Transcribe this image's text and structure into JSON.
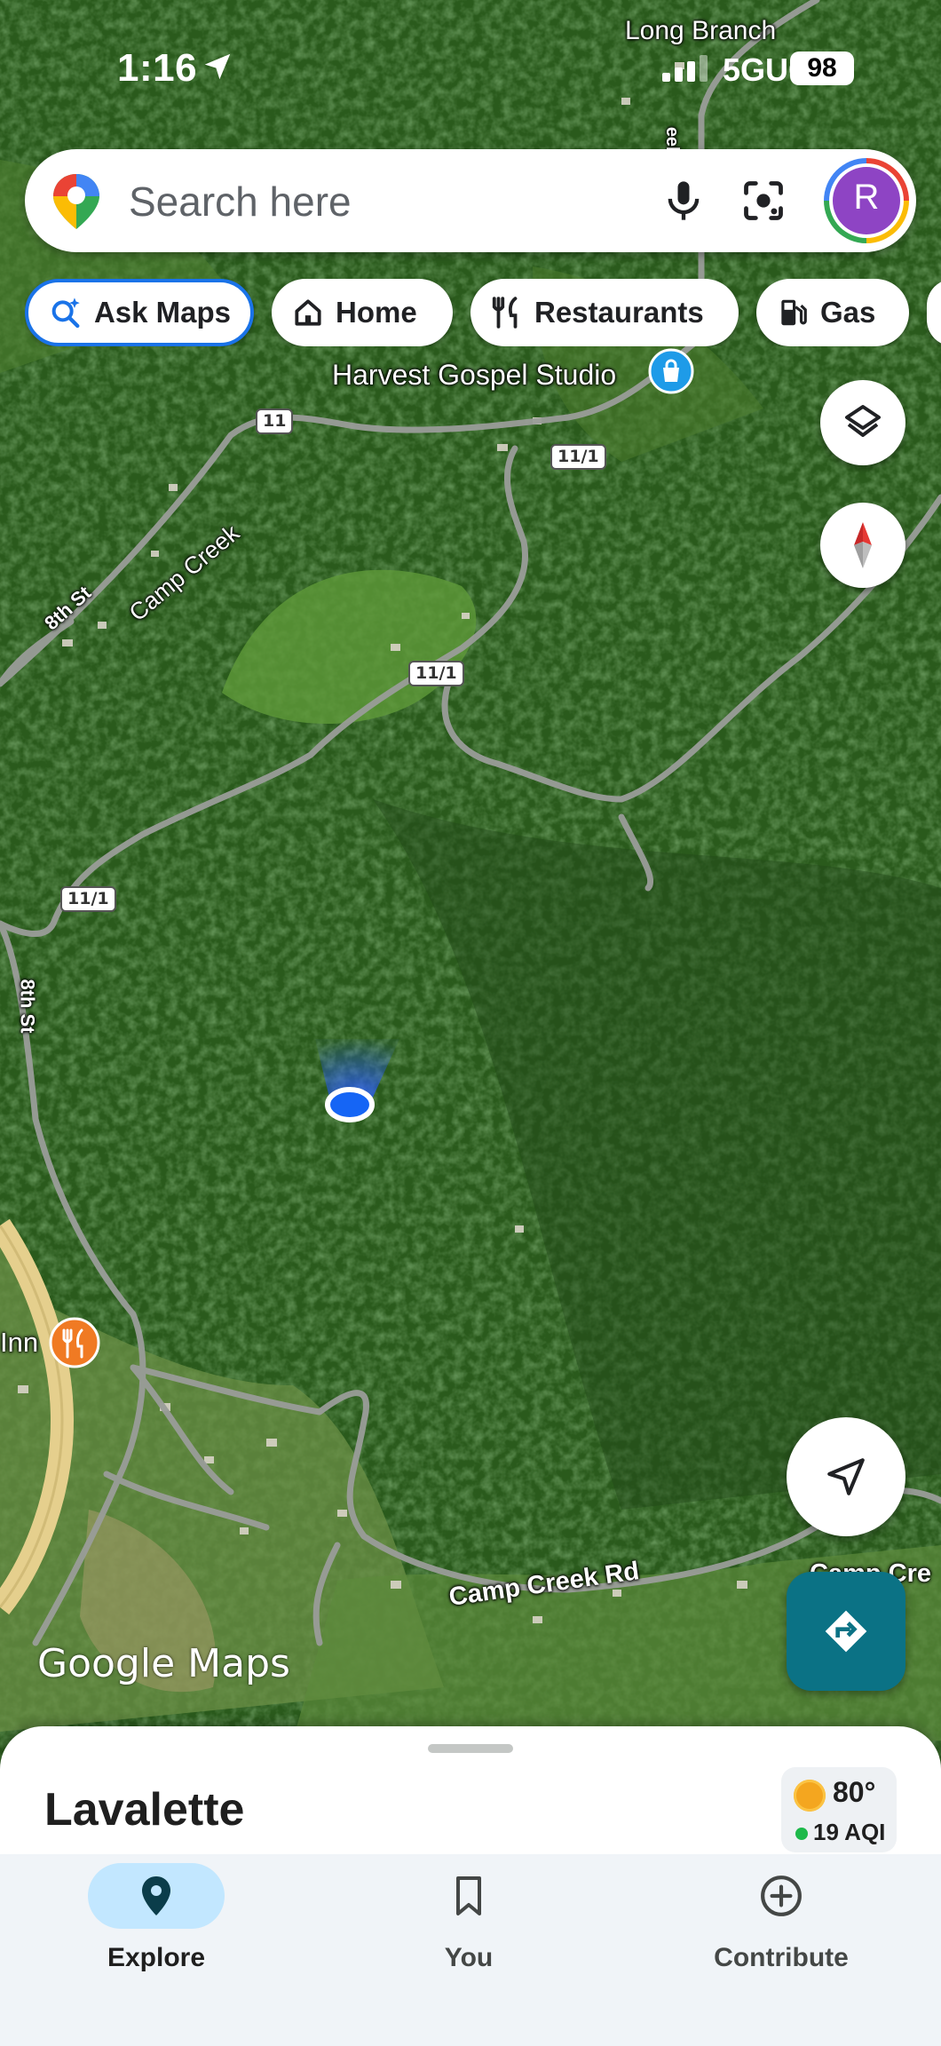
{
  "status_bar": {
    "time": "1:16",
    "network": "5GUC",
    "battery": "98"
  },
  "search": {
    "placeholder": "Search here",
    "avatar_initial": "R"
  },
  "chips": [
    {
      "label": "Ask Maps",
      "icon": "sparkle-search-icon"
    },
    {
      "label": "Home",
      "icon": "home-icon"
    },
    {
      "label": "Restaurants",
      "icon": "fork-knife-icon"
    },
    {
      "label": "Gas",
      "icon": "gas-pump-icon"
    }
  ],
  "map": {
    "labels": {
      "long_branch": "Long Branch",
      "harvest_gospel": "Harvest Gospel Studio",
      "camp_creek": "Camp Creek",
      "eighth_st_top": "8th St",
      "eighth_st_left": "8th St",
      "camp_creek_rd": "Camp Creek Rd",
      "camp_cre_partial": "Camp Cre",
      "inn_partial": "Inn",
      "eek_partial": "eek"
    },
    "shields": {
      "s11": "11",
      "s11_1_a": "11/1",
      "s11_1_b": "11/1",
      "s11_1_c": "11/1"
    },
    "watermark": "Google Maps"
  },
  "sheet": {
    "place_name": "Lavalette",
    "weather_temp": "80°",
    "weather_aqi": "19 AQI"
  },
  "nav": {
    "explore": "Explore",
    "you": "You",
    "contribute": "Contribute"
  },
  "colors": {
    "accent_blue": "#1a73e8",
    "directions_teal": "#0b7285",
    "nav_active_pill": "#c2e7ff",
    "location_dot": "#1565f5"
  }
}
